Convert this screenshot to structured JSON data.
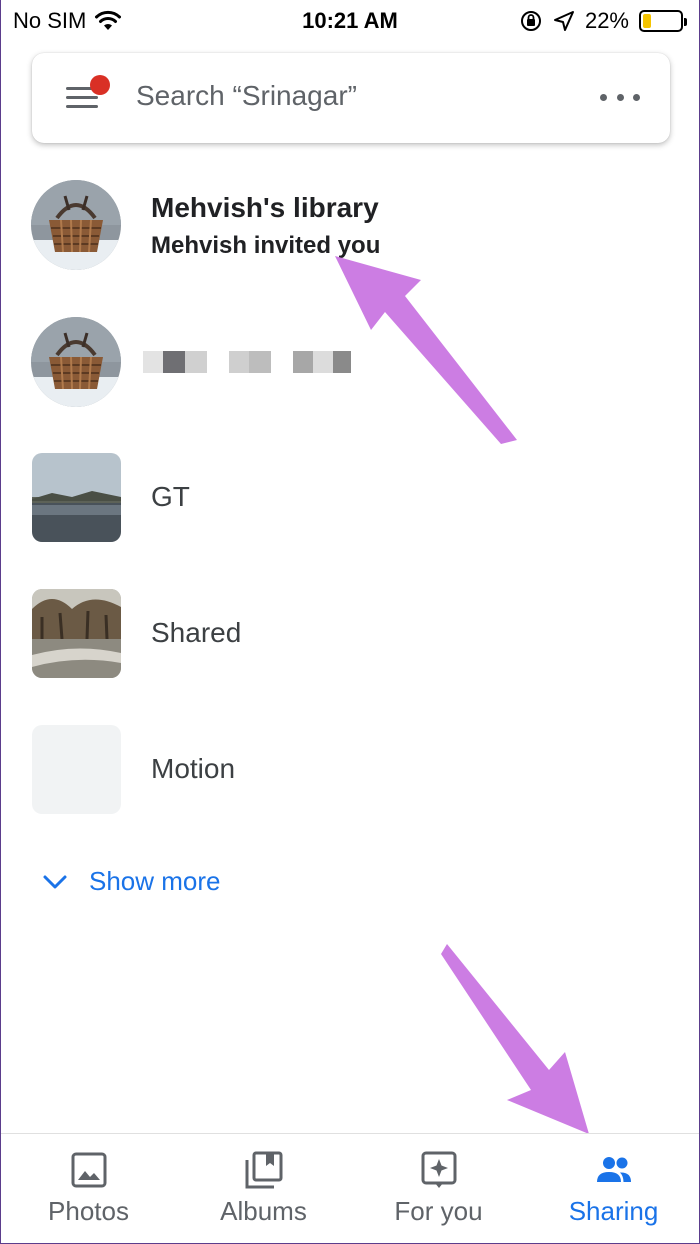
{
  "status": {
    "carrier": "No SIM",
    "time": "10:21 AM",
    "battery": "22%",
    "battery_level": 0.22
  },
  "search": {
    "placeholder": "Search “Srinagar”"
  },
  "library": {
    "title": "Mehvish's library",
    "subtitle": "Mehvish invited you"
  },
  "albums": [
    {
      "title": "GT"
    },
    {
      "title": "Shared"
    },
    {
      "title": "Motion"
    }
  ],
  "show_more": "Show more",
  "nav": {
    "tabs": [
      {
        "label": "Photos",
        "icon": "photo-icon"
      },
      {
        "label": "Albums",
        "icon": "albums-icon"
      },
      {
        "label": "For you",
        "icon": "for-you-icon"
      },
      {
        "label": "Sharing",
        "icon": "sharing-icon"
      }
    ],
    "active": "Sharing"
  },
  "colors": {
    "accent": "#1a73e8",
    "notification_dot": "#d93025",
    "annotation_arrow": "#cc7de3"
  }
}
